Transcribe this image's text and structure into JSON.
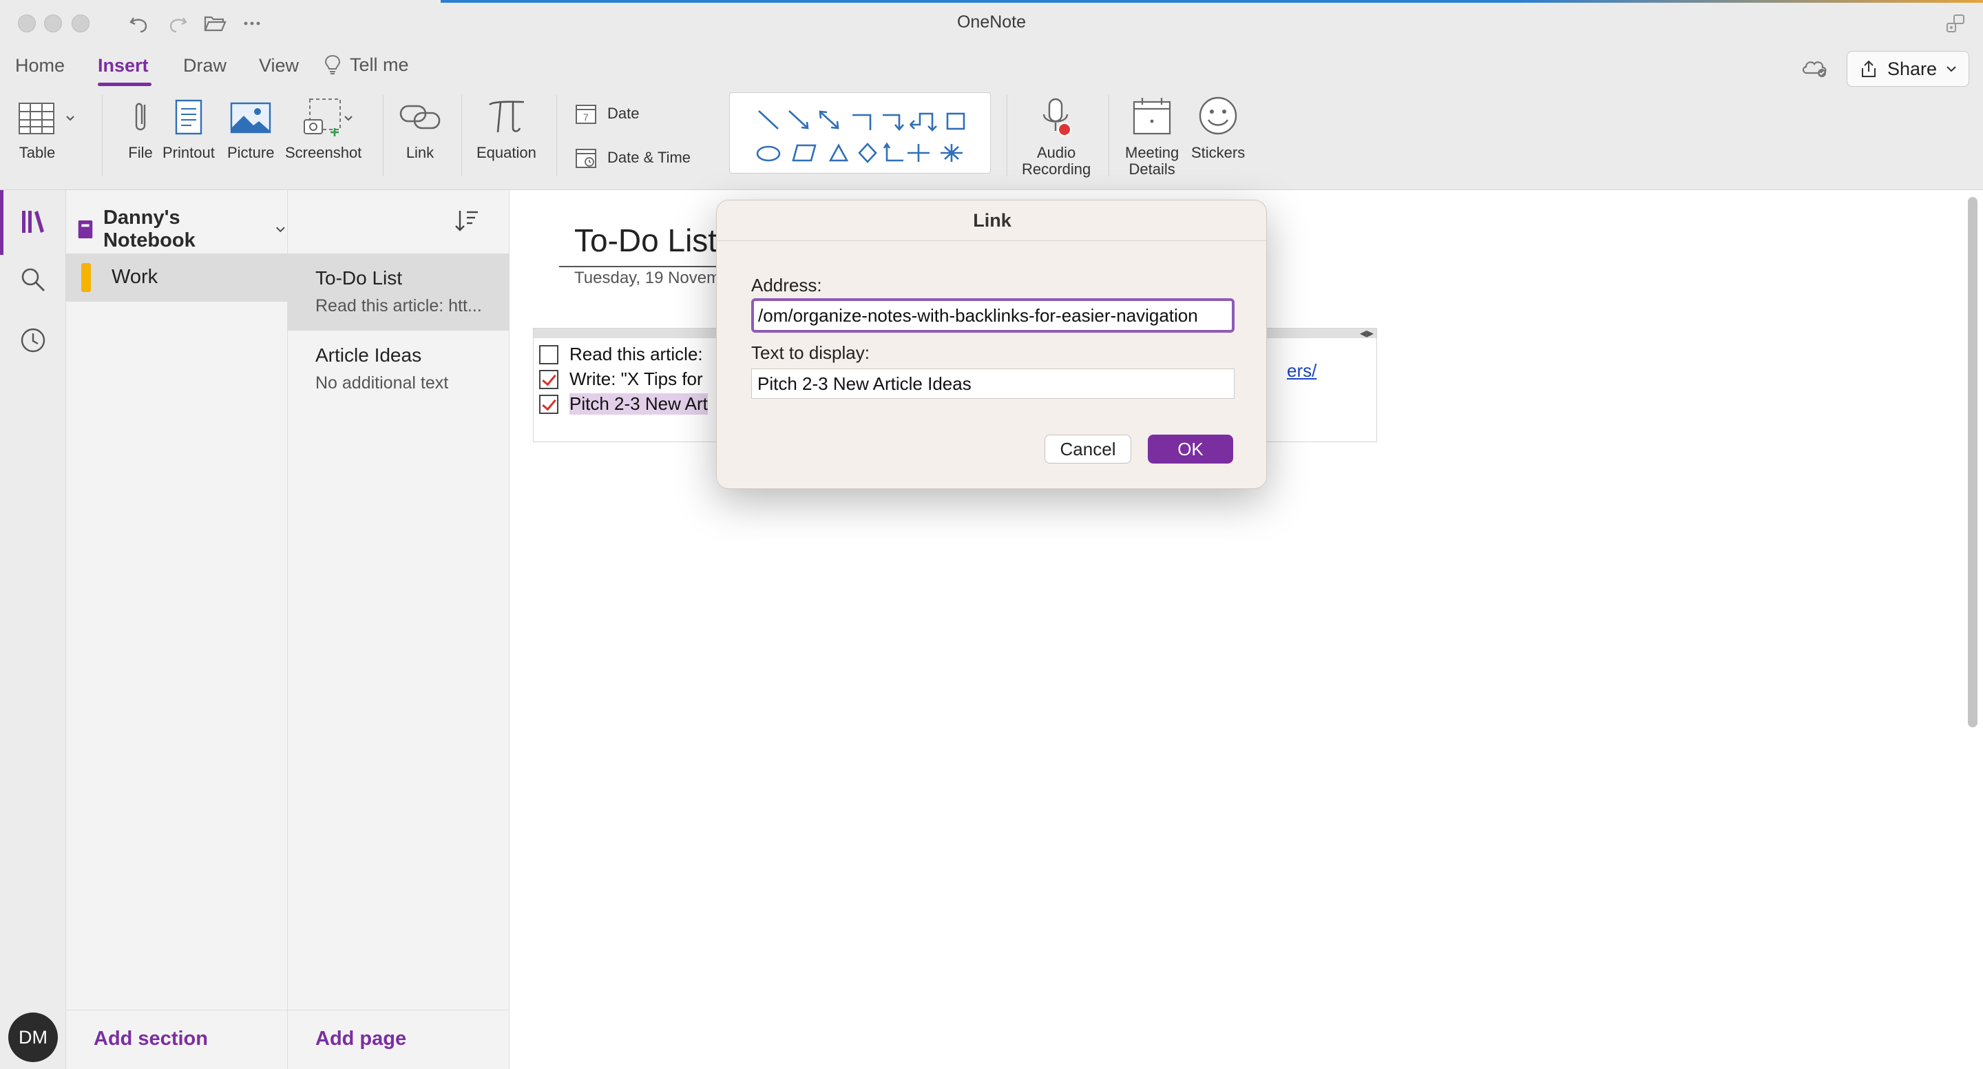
{
  "app": {
    "title": "OneNote"
  },
  "tabs": [
    {
      "label": "Home"
    },
    {
      "label": "Insert"
    },
    {
      "label": "Draw"
    },
    {
      "label": "View"
    }
  ],
  "tell_me": "Tell me",
  "share_label": "Share",
  "ribbon": {
    "table": "Table",
    "file": "File",
    "printout": "Printout",
    "picture": "Picture",
    "screenshot": "Screenshot",
    "link": "Link",
    "equation": "Equation",
    "date": "Date",
    "date_time": "Date & Time",
    "audio_line1": "Audio",
    "audio_line2": "Recording",
    "meeting_line1": "Meeting",
    "meeting_line2": "Details",
    "stickers": "Stickers",
    "date_icon_number": "7"
  },
  "notebook": {
    "name": "Danny's Notebook"
  },
  "sections": [
    {
      "label": "Work",
      "color": "#f4b400"
    }
  ],
  "add_section": "Add section",
  "pages": [
    {
      "title": "To-Do List",
      "snippet": "Read this article: htt..."
    },
    {
      "title": "Article Ideas",
      "snippet": "No additional text"
    }
  ],
  "add_page": "Add page",
  "avatar_initials": "DM",
  "note": {
    "title": "To-Do List",
    "date": "Tuesday, 19 Novem",
    "todos": [
      {
        "text": "Read this article:",
        "checked": false
      },
      {
        "text": "Write: \"X Tips for",
        "checked": true
      },
      {
        "text": "Pitch 2-3 New Art",
        "checked": true
      }
    ],
    "link_fragment": "ers/"
  },
  "dialog": {
    "title": "Link",
    "address_label": "Address:",
    "address_value": "om/organize-notes-with-backlinks-for-easier-navigation/",
    "display_label": "Text to display:",
    "display_value": "Pitch 2-3 New Article Ideas",
    "cancel": "Cancel",
    "ok": "OK"
  },
  "colors": {
    "accent": "#7a2ea0",
    "highlight": "#e3cfe9",
    "section_work": "#f4b400"
  }
}
